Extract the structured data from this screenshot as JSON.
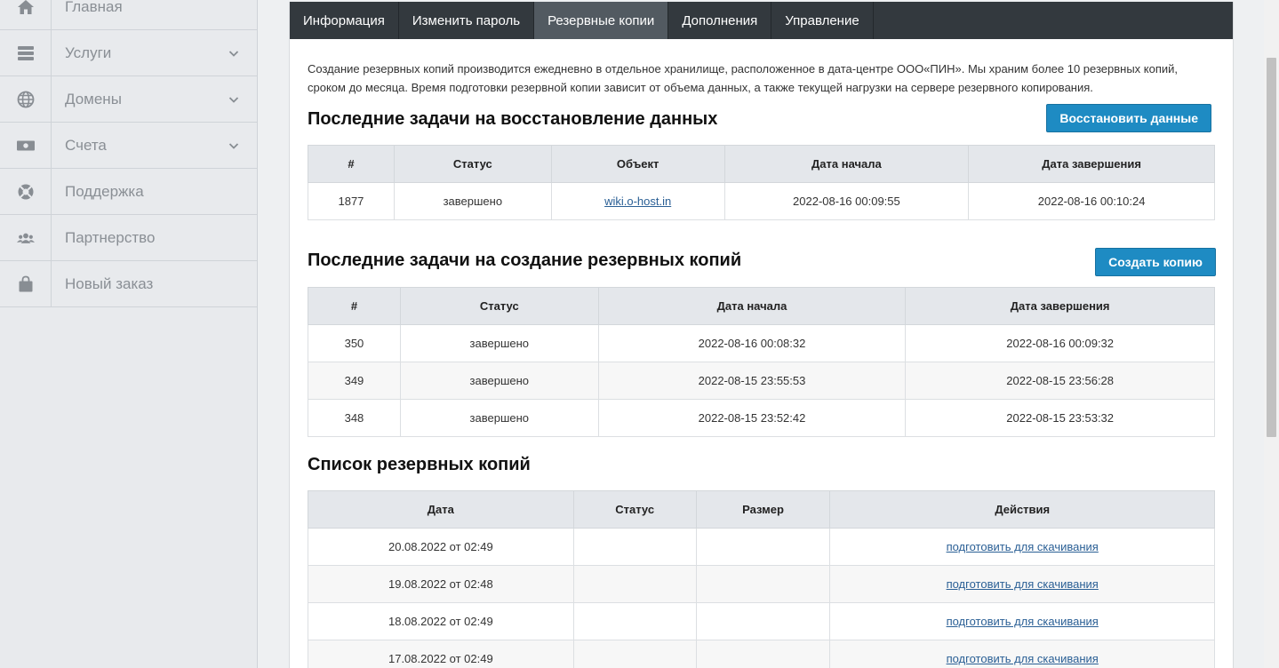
{
  "sidebar": {
    "items": [
      {
        "label": "Главная",
        "icon": "home-icon",
        "has_submenu": false
      },
      {
        "label": "Услуги",
        "icon": "server-icon",
        "has_submenu": true
      },
      {
        "label": "Домены",
        "icon": "globe-icon",
        "has_submenu": true
      },
      {
        "label": "Счета",
        "icon": "money-icon",
        "has_submenu": true
      },
      {
        "label": "Поддержка",
        "icon": "lifebuoy-icon",
        "has_submenu": false
      },
      {
        "label": "Партнерство",
        "icon": "users-icon",
        "has_submenu": false
      },
      {
        "label": "Новый заказ",
        "icon": "bag-icon",
        "has_submenu": false
      }
    ]
  },
  "tabs": [
    {
      "label": "Информация",
      "active": false
    },
    {
      "label": "Изменить пароль",
      "active": false
    },
    {
      "label": "Резервные копии",
      "active": true
    },
    {
      "label": "Дополнения",
      "active": false
    },
    {
      "label": "Управление",
      "active": false
    }
  ],
  "intro": "Создание резервных копий производится ежедневно в отдельное хранилище, расположенное в дата-центре ООО«ПИН». Мы храним более 10 резервных копий, сроком до месяца. Время подготовки резервной копии зависит от объема данных, а также текущей нагрузки на сервере резервного копирования.",
  "restore": {
    "title": "Последние задачи на восстановление данных",
    "button": "Восстановить данные",
    "headers": [
      "#",
      "Статус",
      "Объект",
      "Дата начала",
      "Дата завершения"
    ],
    "rows": [
      [
        "1877",
        "завершено",
        "wiki.o-host.in",
        "2022-08-16 00:09:55",
        "2022-08-16 00:10:24"
      ]
    ]
  },
  "backup_tasks": {
    "title": "Последние задачи на создание резервных копий",
    "button": "Создать копию",
    "headers": [
      "#",
      "Статус",
      "Дата начала",
      "Дата завершения"
    ],
    "rows": [
      [
        "350",
        "завершено",
        "2022-08-16 00:08:32",
        "2022-08-16 00:09:32"
      ],
      [
        "349",
        "завершено",
        "2022-08-15 23:55:53",
        "2022-08-15 23:56:28"
      ],
      [
        "348",
        "завершено",
        "2022-08-15 23:52:42",
        "2022-08-15 23:53:32"
      ]
    ]
  },
  "backups": {
    "title": "Список резервных копий",
    "headers": [
      "Дата",
      "Статус",
      "Размер",
      "Действия"
    ],
    "rows": [
      [
        "20.08.2022 от 02:49",
        "",
        "",
        "подготовить для скачивания"
      ],
      [
        "19.08.2022 от 02:48",
        "",
        "",
        "подготовить для скачивания"
      ],
      [
        "18.08.2022 от 02:49",
        "",
        "",
        "подготовить для скачивания"
      ],
      [
        "17.08.2022 от 02:49",
        "",
        "",
        "подготовить для скачивания"
      ]
    ]
  },
  "colors": {
    "accent": "#1e8bc3",
    "tabbar": "#33393e",
    "tab_active": "#525a61"
  }
}
